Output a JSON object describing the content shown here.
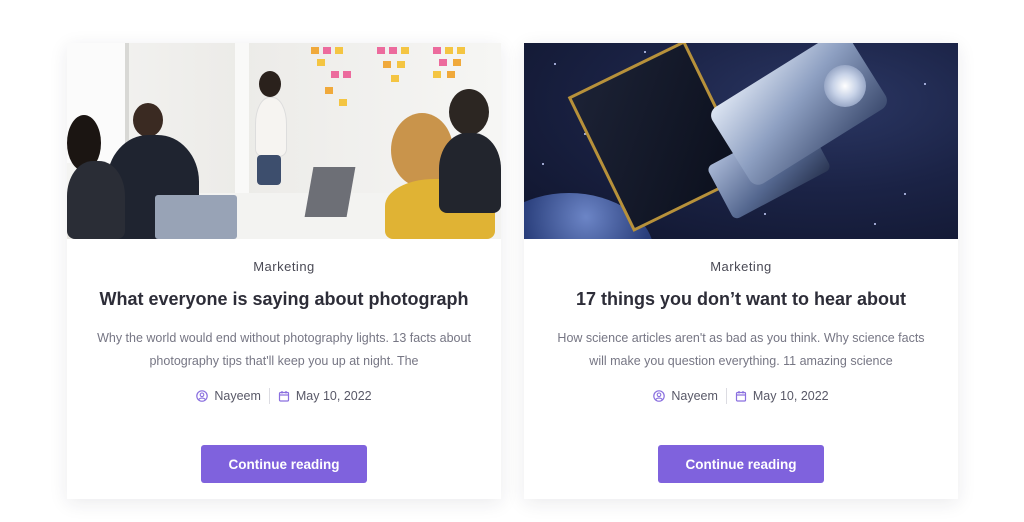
{
  "posts": [
    {
      "image": "team-meeting-photo",
      "category": "Marketing",
      "title": "What everyone is saying about photograph",
      "excerpt": "Why the world would end without photography lights. 13 facts about photography tips that'll keep you up at night. The",
      "author": "Nayeem",
      "date": "May 10, 2022",
      "cta": "Continue reading"
    },
    {
      "image": "satellite-in-space-photo",
      "category": "Marketing",
      "title": "17 things you don’t want to hear about",
      "excerpt": "How science articles aren't as bad as you think. Why science facts will make you question everything. 11 amazing science",
      "author": "Nayeem",
      "date": "May 10, 2022",
      "cta": "Continue reading"
    }
  ],
  "colors": {
    "accent": "#7f62dd",
    "icon": "#8a6fdf",
    "title": "#2d2d38",
    "body": "#767684"
  },
  "icons": {
    "author": "user-circle-icon",
    "date": "calendar-icon"
  }
}
